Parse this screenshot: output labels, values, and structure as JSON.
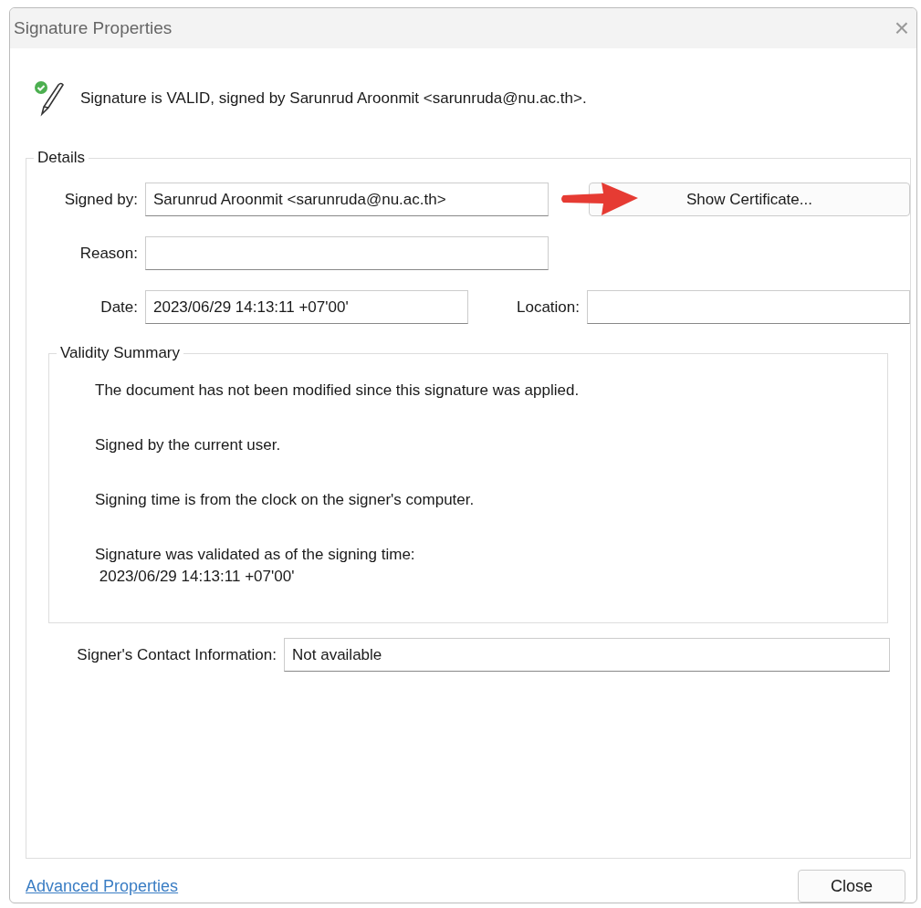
{
  "window": {
    "title": "Signature Properties",
    "close": "×"
  },
  "status": "Signature is VALID, signed by Sarunrud Aroonmit <sarunruda@nu.ac.th>.",
  "details": {
    "legend": "Details",
    "signed_by": {
      "label": "Signed by:",
      "value": "Sarunrud Aroonmit <sarunruda@nu.ac.th>"
    },
    "show_certificate": "Show Certificate...",
    "reason": {
      "label": "Reason:"
    },
    "date": {
      "label": "Date:",
      "value": "2023/06/29 14:13:11 +07'00'"
    },
    "location": {
      "label": "Location:"
    },
    "validity_summary": {
      "legend": "Validity Summary",
      "items": [
        {
          "lines": [
            "The document has not been modified since this signature was applied."
          ]
        },
        {
          "lines": [
            "Signed by the current user."
          ]
        },
        {
          "lines": [
            "Signing time is from the clock on the signer's computer."
          ]
        },
        {
          "lines": [
            "Signature was validated as of the signing time:",
            " 2023/06/29 14:13:11 +07'00'"
          ]
        }
      ]
    },
    "contact": {
      "label": "Signer's Contact Information:",
      "value": "Not available"
    }
  },
  "footer": {
    "link": "Advanced Properties",
    "close_button": "Close"
  }
}
